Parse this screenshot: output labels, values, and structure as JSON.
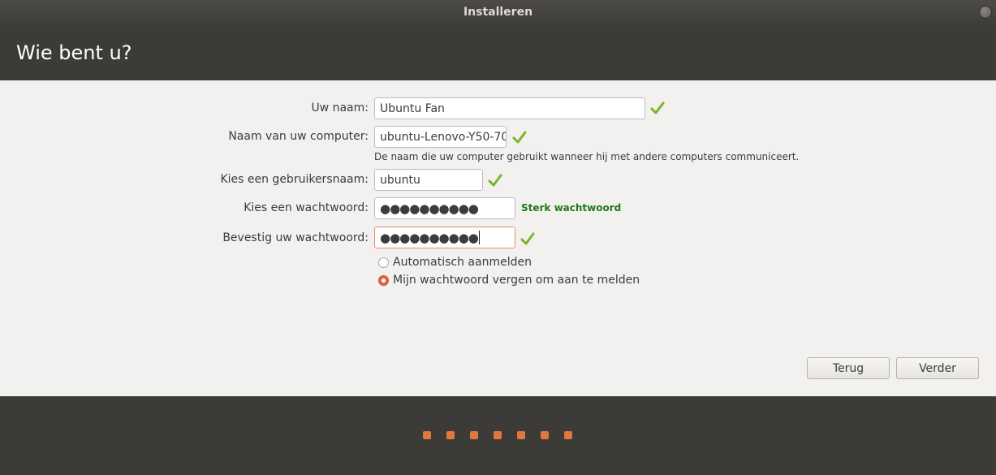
{
  "window": {
    "title": "Installeren"
  },
  "page": {
    "heading": "Wie bent u?"
  },
  "form": {
    "name": {
      "label": "Uw naam:",
      "value": "Ubuntu Fan"
    },
    "computer": {
      "label": "Naam van uw computer:",
      "value": "ubuntu-Lenovo-Y50-70",
      "hint": "De naam die uw computer gebruikt wanneer hij met andere computers communiceert."
    },
    "username": {
      "label": "Kies een gebruikersnaam:",
      "value": "ubuntu"
    },
    "password": {
      "label": "Kies een wachtwoord:",
      "value": "●●●●●●●●●●",
      "strength": "Sterk wachtwoord"
    },
    "confirm": {
      "label": "Bevestig uw wachtwoord:",
      "value": "●●●●●●●●●●"
    },
    "login_options": [
      {
        "label": "Automatisch aanmelden",
        "selected": false
      },
      {
        "label": "Mijn wachtwoord vergen om aan te melden",
        "selected": true
      }
    ]
  },
  "buttons": {
    "back": "Terug",
    "next": "Verder"
  },
  "progress": {
    "steps": 7
  },
  "colors": {
    "accent": "#e0773f",
    "check": "#7cb32a",
    "strong": "#1e7a16"
  },
  "icons": {
    "valid": "check-icon",
    "close": "close-icon"
  }
}
